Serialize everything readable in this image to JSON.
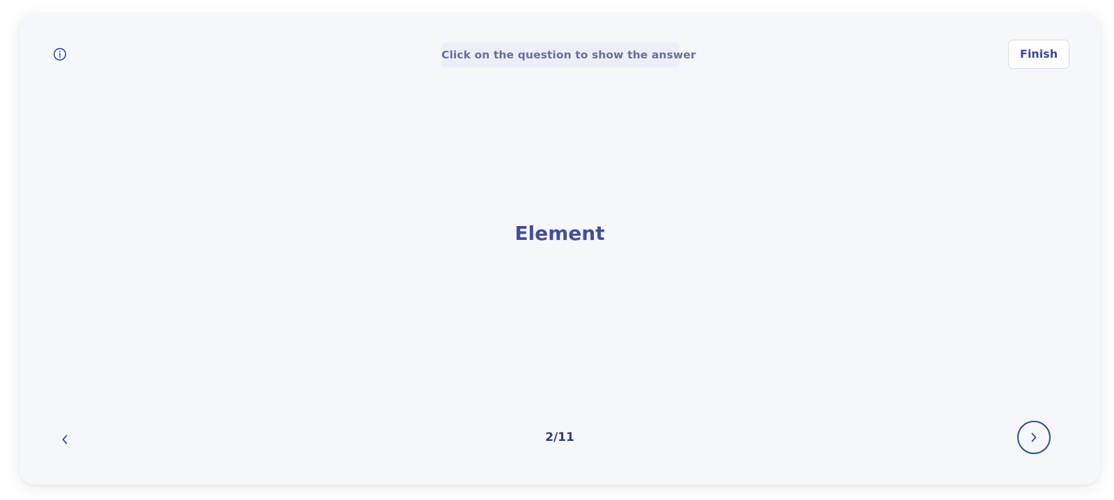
{
  "header": {
    "info_icon": "info-icon",
    "hint_text": "Click on the question to show the answer",
    "finish_label": "Finish"
  },
  "card": {
    "question": "Element"
  },
  "footer": {
    "prev_icon": "chevron-left-icon",
    "counter": "2/11",
    "next_icon": "chevron-right-icon"
  },
  "colors": {
    "card_background": "#f6f7fa",
    "accent": "#434ea0",
    "next_border": "#2f4e9c"
  }
}
